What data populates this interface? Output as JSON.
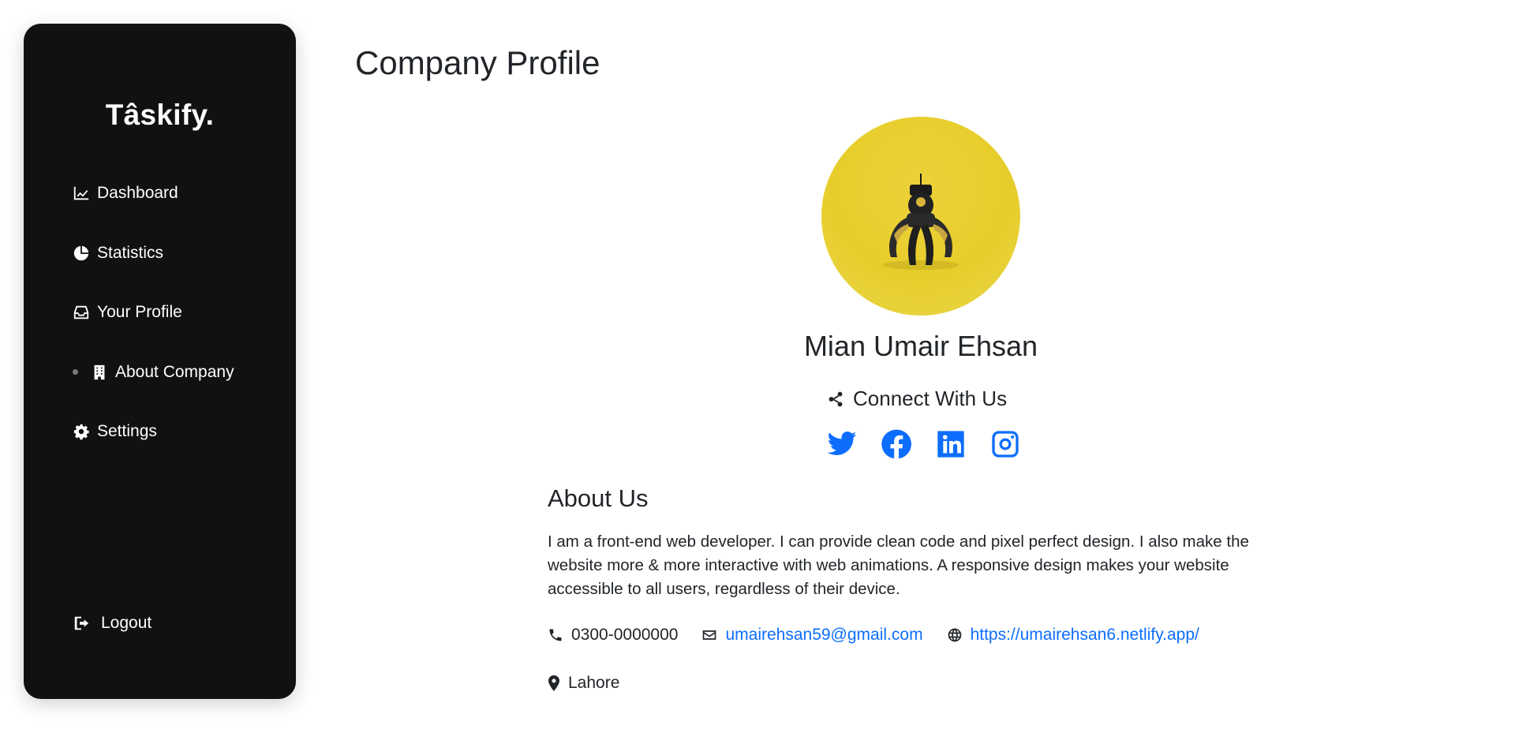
{
  "sidebar": {
    "brand": "Tâskify.",
    "items": [
      {
        "label": "Dashboard",
        "icon": "chart-line-icon",
        "active": false
      },
      {
        "label": "Statistics",
        "icon": "pie-chart-icon",
        "active": false
      },
      {
        "label": "Your Profile",
        "icon": "inbox-icon",
        "active": false
      },
      {
        "label": "About Company",
        "icon": "building-icon",
        "active": true
      },
      {
        "label": "Settings",
        "icon": "gear-icon",
        "active": false
      }
    ],
    "logout_label": "Logout",
    "logout_icon": "sign-out-icon"
  },
  "page": {
    "title": "Company Profile"
  },
  "profile": {
    "name": "Mian Umair Ehsan",
    "connect_label": "Connect With Us",
    "connect_icon": "share-icon",
    "socials": [
      "twitter-icon",
      "facebook-icon",
      "linkedin-icon",
      "instagram-icon"
    ],
    "accent_color": "#0d6efd"
  },
  "about": {
    "heading": "About Us",
    "text": "I am a front-end web developer. I can provide clean code and pixel perfect design. I also make the website more & more interactive with web animations. A responsive design makes your website accessible to all users, regardless of their device.",
    "phone": "0300-0000000",
    "email": "umairehsan59@gmail.com",
    "website": "https://umairehsan6.netlify.app/",
    "location": "Lahore"
  },
  "colors": {
    "sidebar_bg": "#111111",
    "link": "#0d6efd",
    "avatar_bg": "#e8ce2e"
  }
}
